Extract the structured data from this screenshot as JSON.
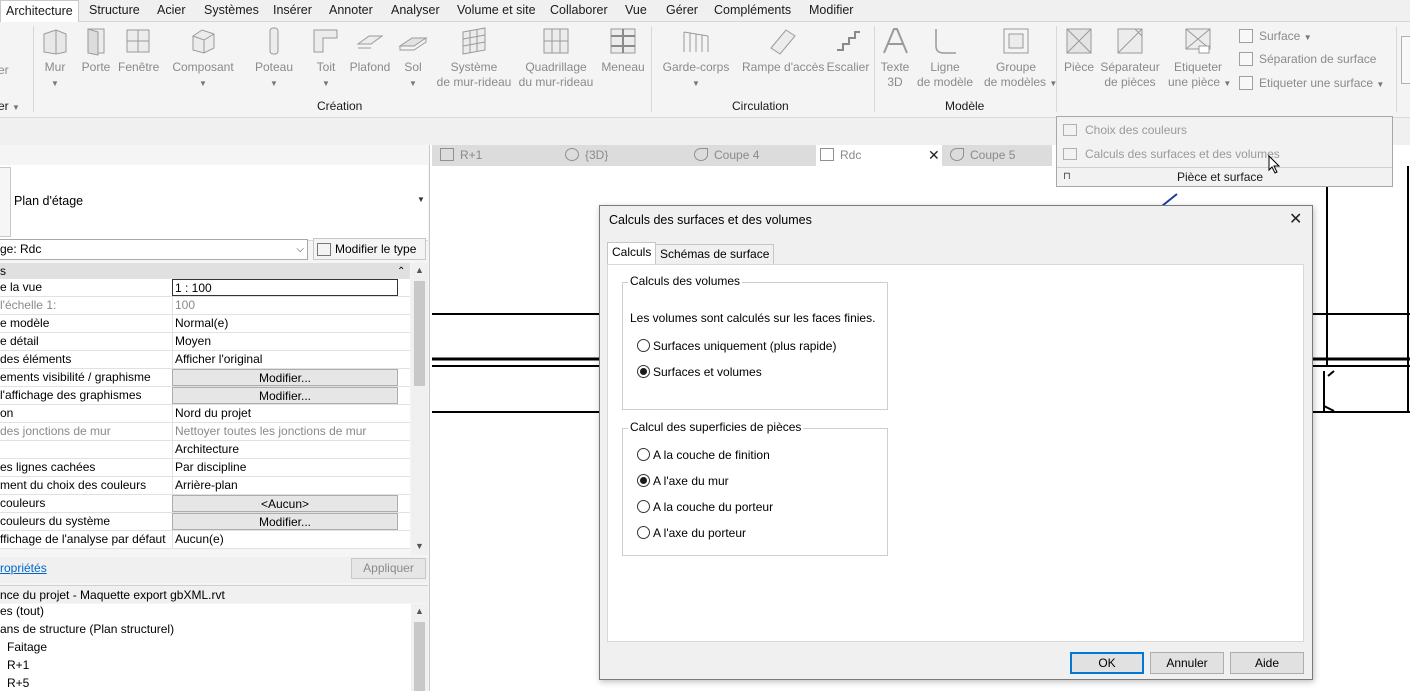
{
  "menubar": {
    "items": [
      "Architecture",
      "Structure",
      "Acier",
      "Systèmes",
      "Insérer",
      "Annoter",
      "Analyser",
      "Volume et site",
      "Collaborer",
      "Vue",
      "Gérer",
      "Compléments",
      "Modifier"
    ],
    "active": "Architecture"
  },
  "ribbon": {
    "partial_left": {
      "tool": "er",
      "bottom": "er"
    },
    "tools": [
      {
        "l1": "Mur",
        "l2": ""
      },
      {
        "l1": "Porte",
        "l2": ""
      },
      {
        "l1": "Fenêtre",
        "l2": ""
      },
      {
        "l1": "Composant",
        "l2": ""
      },
      {
        "l1": "Poteau",
        "l2": ""
      },
      {
        "l1": "Toit",
        "l2": ""
      },
      {
        "l1": "Plafond",
        "l2": ""
      },
      {
        "l1": "Sol",
        "l2": ""
      },
      {
        "l1": "Système",
        "l2": "de mur-rideau"
      },
      {
        "l1": "Quadrillage",
        "l2": "du mur-rideau"
      },
      {
        "l1": "Meneau",
        "l2": ""
      },
      {
        "l1": "Garde-corps",
        "l2": ""
      },
      {
        "l1": "Rampe d'accès",
        "l2": ""
      },
      {
        "l1": "Escalier",
        "l2": ""
      },
      {
        "l1": "Texte",
        "l2": "3D"
      },
      {
        "l1": "Ligne",
        "l2": "de modèle"
      },
      {
        "l1": "Groupe",
        "l2": "de modèles"
      },
      {
        "l1": "Pièce",
        "l2": ""
      },
      {
        "l1": "Séparateur",
        "l2": "de pièces"
      },
      {
        "l1": "Etiqueter",
        "l2": "une pièce"
      }
    ],
    "panels": [
      "Création",
      "Circulation",
      "Modèle"
    ],
    "small_tools": [
      "Surface",
      "Séparation  de surface",
      "Etiqueter  une surface"
    ]
  },
  "dropdown": {
    "items": [
      "Choix des couleurs",
      "Calculs des surfaces et des volumes"
    ],
    "footer": "Pièce et surface"
  },
  "properties": {
    "type_name": "Plan d'étage",
    "view_selector": "ge: Rdc",
    "edit_type": "Modifier le type",
    "group_header": "s",
    "rows": [
      {
        "k": "e la vue",
        "v": "1 : 100"
      },
      {
        "k": "l'échelle    1:",
        "v": "100"
      },
      {
        "k": "e modèle",
        "v": "Normal(e)"
      },
      {
        "k": "e détail",
        "v": "Moyen"
      },
      {
        "k": "des éléments",
        "v": "Afficher l'original"
      },
      {
        "k": "ements visibilité / graphisme",
        "v": "Modifier..."
      },
      {
        "k": "l'affichage des graphismes",
        "v": "Modifier..."
      },
      {
        "k": "on",
        "v": "Nord du projet"
      },
      {
        "k": " des jonctions de mur",
        "v": "Nettoyer toutes les jonctions de mur"
      },
      {
        "k": "",
        "v": "Architecture"
      },
      {
        "k": "es lignes cachées",
        "v": "Par discipline"
      },
      {
        "k": "ment du choix des couleurs",
        "v": "Arrière-plan"
      },
      {
        "k": " couleurs",
        "v": "<Aucun>"
      },
      {
        "k": " couleurs du système",
        "v": "Modifier..."
      },
      {
        "k": "ffichage de l'analyse par défaut",
        "v": "Aucun(e)"
      }
    ],
    "help_link": "ropriétés",
    "apply": "Appliquer"
  },
  "browser": {
    "title": "nce du projet - Maquette export gbXML.rvt",
    "items": [
      "es (tout)",
      "ans de structure (Plan structurel)",
      "Faitage",
      "R+1",
      "R+5"
    ]
  },
  "view_tabs": [
    "R+1",
    "{3D}",
    "Coupe 4",
    "Rdc",
    "Coupe 5"
  ],
  "dialog": {
    "title": "Calculs des surfaces et des volumes",
    "tabs": [
      "Calculs",
      "Schémas de surface"
    ],
    "volumes": {
      "title": "Calculs des volumes",
      "note": "Les volumes sont calculés sur les faces finies.",
      "options": [
        "Surfaces uniquement (plus rapide)",
        "Surfaces et volumes"
      ],
      "selected": 1
    },
    "rooms": {
      "title": "Calcul des superficies de pièces",
      "options": [
        "A la couche de finition",
        "A l'axe du mur",
        "A la couche du porteur",
        "A l'axe du porteur"
      ],
      "selected": 1
    },
    "buttons": {
      "ok": "OK",
      "cancel": "Annuler",
      "help": "Aide"
    }
  }
}
